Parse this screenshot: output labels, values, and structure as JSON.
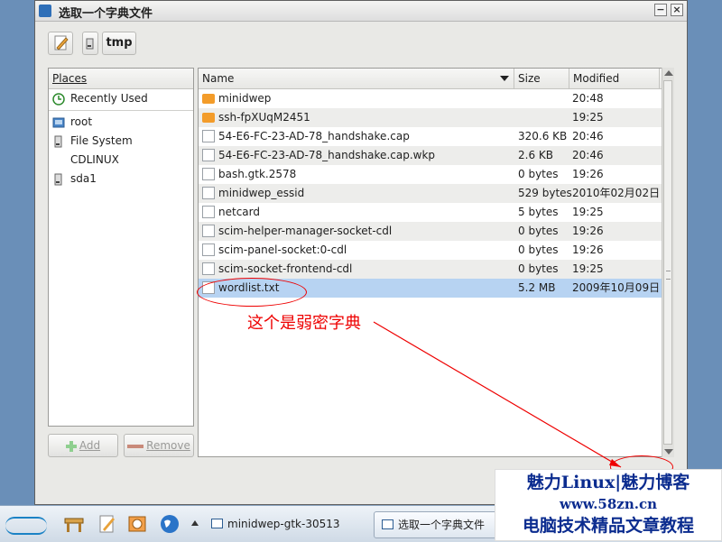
{
  "window": {
    "title": "选取一个字典文件"
  },
  "path_bar": {
    "current": "tmp"
  },
  "places": {
    "header": "Places",
    "items": [
      {
        "label": "Recently Used",
        "icon": "recent-icon"
      },
      {
        "label": "root",
        "icon": "home-icon"
      },
      {
        "label": "File System",
        "icon": "drive-icon"
      },
      {
        "label": "CDLINUX",
        "icon": "none"
      },
      {
        "label": "sda1",
        "icon": "drive-icon"
      }
    ],
    "add_label": "Add",
    "remove_label": "Remove"
  },
  "files": {
    "columns": {
      "name": "Name",
      "size": "Size",
      "modified": "Modified"
    },
    "rows": [
      {
        "name": "minidwep",
        "size": "",
        "modified": "20:48",
        "type": "folder"
      },
      {
        "name": "ssh-fpXUqM2451",
        "size": "",
        "modified": "19:25",
        "type": "folder"
      },
      {
        "name": "54-E6-FC-23-AD-78_handshake.cap",
        "size": "320.6 KB",
        "modified": "20:46",
        "type": "file"
      },
      {
        "name": "54-E6-FC-23-AD-78_handshake.cap.wkp",
        "size": "2.6 KB",
        "modified": "20:46",
        "type": "file"
      },
      {
        "name": "bash.gtk.2578",
        "size": "0 bytes",
        "modified": "19:26",
        "type": "file"
      },
      {
        "name": "minidwep_essid",
        "size": "529 bytes",
        "modified": "2010年02月02日",
        "type": "file"
      },
      {
        "name": "netcard",
        "size": "5 bytes",
        "modified": "19:25",
        "type": "file"
      },
      {
        "name": "scim-helper-manager-socket-cdl",
        "size": "0 bytes",
        "modified": "19:26",
        "type": "file"
      },
      {
        "name": "scim-panel-socket:0-cdl",
        "size": "0 bytes",
        "modified": "19:26",
        "type": "file"
      },
      {
        "name": "scim-socket-frontend-cdl",
        "size": "0 bytes",
        "modified": "19:25",
        "type": "file"
      },
      {
        "name": "wordlist.txt",
        "size": "5.2 MB",
        "modified": "2009年10月09日",
        "type": "file",
        "selected": true
      }
    ]
  },
  "annotation": {
    "text": "这个是弱密字典"
  },
  "taskbar": {
    "tasks": [
      {
        "label": "minidwep-gtk-30513"
      },
      {
        "label": "选取一个字典文件"
      }
    ]
  },
  "watermark": {
    "line1": "魅力Linux|魅力博客",
    "line2": "www.58zn.cn",
    "line3": "电脑技术精品文章教程"
  },
  "colors": {
    "selection": "#b7d3f2",
    "annotation": "#e00000",
    "folder": "#f39c2a"
  }
}
